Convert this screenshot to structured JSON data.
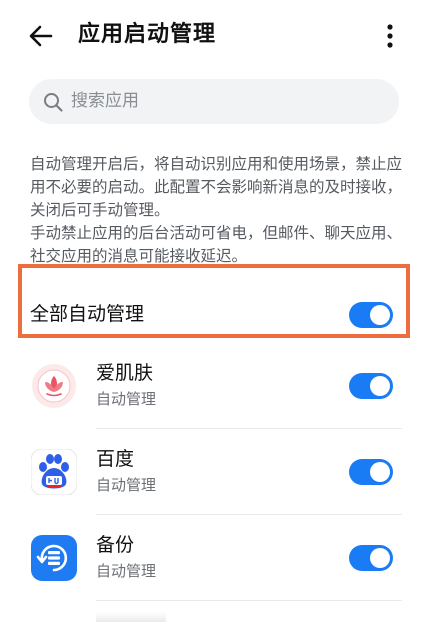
{
  "header": {
    "title": "应用启动管理",
    "back_icon": "arrow-left-icon",
    "more_icon": "more-vertical-icon"
  },
  "search": {
    "placeholder": "搜索应用",
    "icon": "search-icon"
  },
  "description": {
    "paragraph_1": "自动管理开启后，将自动识别应用和使用场景，禁止应用不必要的启动。此配置不会影响新消息的及时接收，关闭后可手动管理。",
    "paragraph_2": "手动禁止应用的后台活动可省电，但邮件、聊天应用、社交应用的消息可能接收延迟。"
  },
  "all_auto": {
    "label": "全部自动管理",
    "enabled": true
  },
  "apps": [
    {
      "name": "爱肌肤",
      "status": "自动管理",
      "enabled": true,
      "icon": "lotus-icon"
    },
    {
      "name": "百度",
      "status": "自动管理",
      "enabled": true,
      "icon": "baidu-paw-icon"
    },
    {
      "name": "备份",
      "status": "自动管理",
      "enabled": true,
      "icon": "backup-icon"
    }
  ],
  "colors": {
    "accent": "#1a7cf5",
    "highlight_border": "#ec6d3e",
    "search_bg": "#f1f3f5"
  }
}
